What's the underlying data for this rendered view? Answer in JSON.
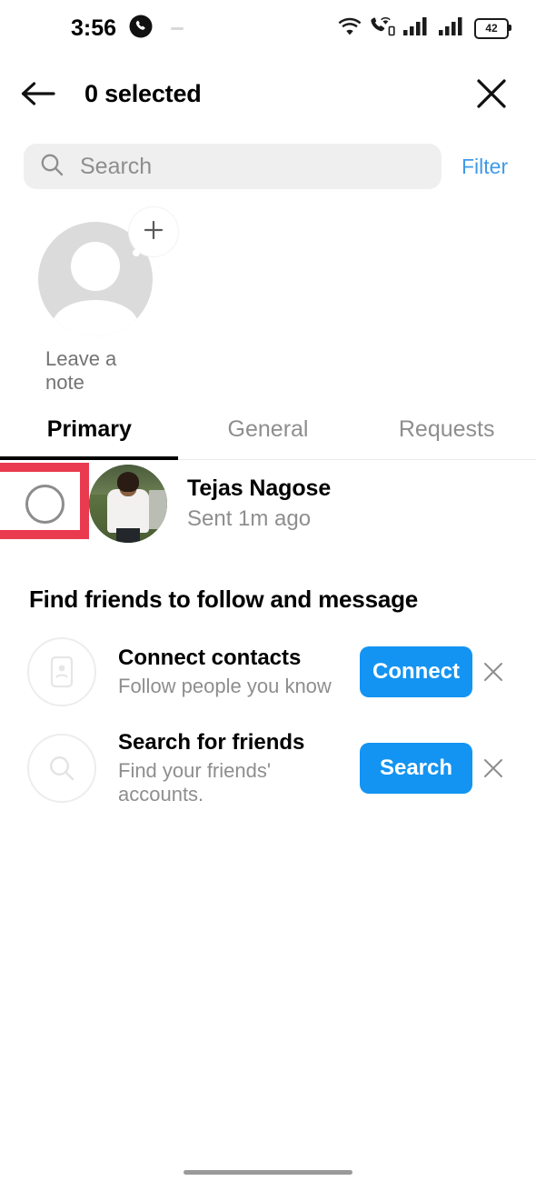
{
  "status_bar": {
    "time": "3:56",
    "notification_icon": "phone-call-icon",
    "dash_icon": "placeholder-dash-icon",
    "wifi_icon": "wifi-icon",
    "vowifi_icon": "call-over-wifi-icon",
    "signal_icon_1": "cellular-signal-icon",
    "signal_icon_2": "cellular-signal-icon",
    "battery_level": "42",
    "battery_icon": "battery-icon"
  },
  "header": {
    "back_icon": "arrow-left-icon",
    "title": "0 selected",
    "close_icon": "close-x-icon"
  },
  "search": {
    "icon": "search-icon",
    "placeholder": "Search",
    "value": "",
    "filter_label": "Filter"
  },
  "note": {
    "label": "Leave a note",
    "avatar_icon": "default-avatar-icon",
    "add_icon": "plus-icon"
  },
  "tabs": [
    {
      "label": "Primary",
      "active": true
    },
    {
      "label": "General",
      "active": false
    },
    {
      "label": "Requests",
      "active": false
    }
  ],
  "thread": {
    "selector_icon": "unchecked-circle-icon",
    "selected": false,
    "avatar_icon": "user-photo",
    "name": "Tejas Nagose",
    "status": "Sent 1m ago",
    "highlight_color": "#ea3a4f"
  },
  "find_friends": {
    "section_title": "Find friends to follow and message",
    "items": [
      {
        "icon": "contact-card-icon",
        "title": "Connect contacts",
        "subtitle": "Follow people you know",
        "button_label": "Connect",
        "dismiss_icon": "close-x-icon"
      },
      {
        "icon": "search-icon",
        "title": "Search for friends",
        "subtitle": "Find your friends' accounts.",
        "button_label": "Search",
        "dismiss_icon": "close-x-icon"
      }
    ]
  },
  "colors": {
    "accent_blue": "#1394f2",
    "filter_blue": "#3f9ae8",
    "highlight_red": "#ea3a4f",
    "muted_gray": "#8e8e8e",
    "field_gray": "#efefef"
  },
  "home_indicator": "home-gesture-bar"
}
